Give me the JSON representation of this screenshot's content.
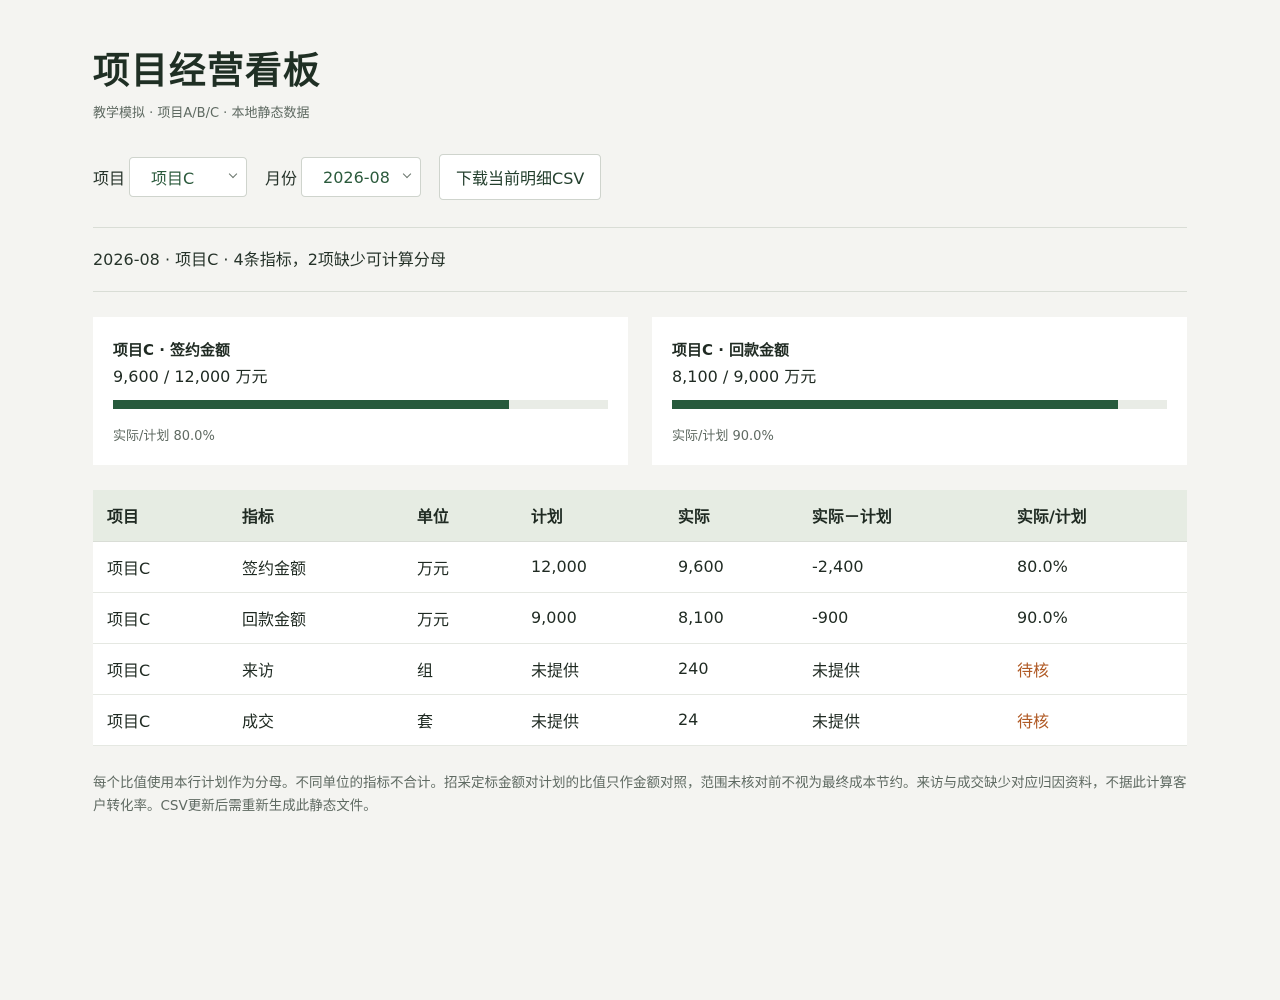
{
  "header": {
    "title": "项目经营看板",
    "subtitle": "教学模拟 · 项目A/B/C · 本地静态数据"
  },
  "controls": {
    "project_label": "项目",
    "project_value": "项目C",
    "month_label": "月份",
    "month_value": "2026-08",
    "download_label": "下载当前明细CSV"
  },
  "summary": "2026-08 · 项目C · 4条指标，2项缺少可计算分母",
  "cards": [
    {
      "title": "项目C · 签约金额",
      "value": "9,600 / 12,000 万元",
      "ratio_text": "实际/计划 80.0%",
      "progress": 0.8
    },
    {
      "title": "项目C · 回款金额",
      "value": "8,100 / 9,000 万元",
      "ratio_text": "实际/计划 90.0%",
      "progress": 0.9
    }
  ],
  "table": {
    "headers": [
      "项目",
      "指标",
      "单位",
      "计划",
      "实际",
      "实际－计划",
      "实际/计划"
    ],
    "rows": [
      [
        "项目C",
        "签约金额",
        "万元",
        "12,000",
        "9,600",
        "-2,400",
        "80.0%"
      ],
      [
        "项目C",
        "回款金额",
        "万元",
        "9,000",
        "8,100",
        "-900",
        "90.0%"
      ],
      [
        "项目C",
        "来访",
        "组",
        "未提供",
        "240",
        "未提供",
        "待核"
      ],
      [
        "项目C",
        "成交",
        "套",
        "未提供",
        "24",
        "未提供",
        "待核"
      ]
    ]
  },
  "footnote": "每个比值使用本行计划作为分母。不同单位的指标不合计。招采定标金额对计划的比值只作金额对照，范围未核对前不视为最终成本节约。来访与成交缺少对应归因资料，不据此计算客户转化率。CSV更新后需重新生成此静态文件。",
  "colors": {
    "accent": "#275a3c",
    "pending": "#b05a25",
    "header_bg": "#e6ece3",
    "page_bg": "#f4f4f1"
  }
}
